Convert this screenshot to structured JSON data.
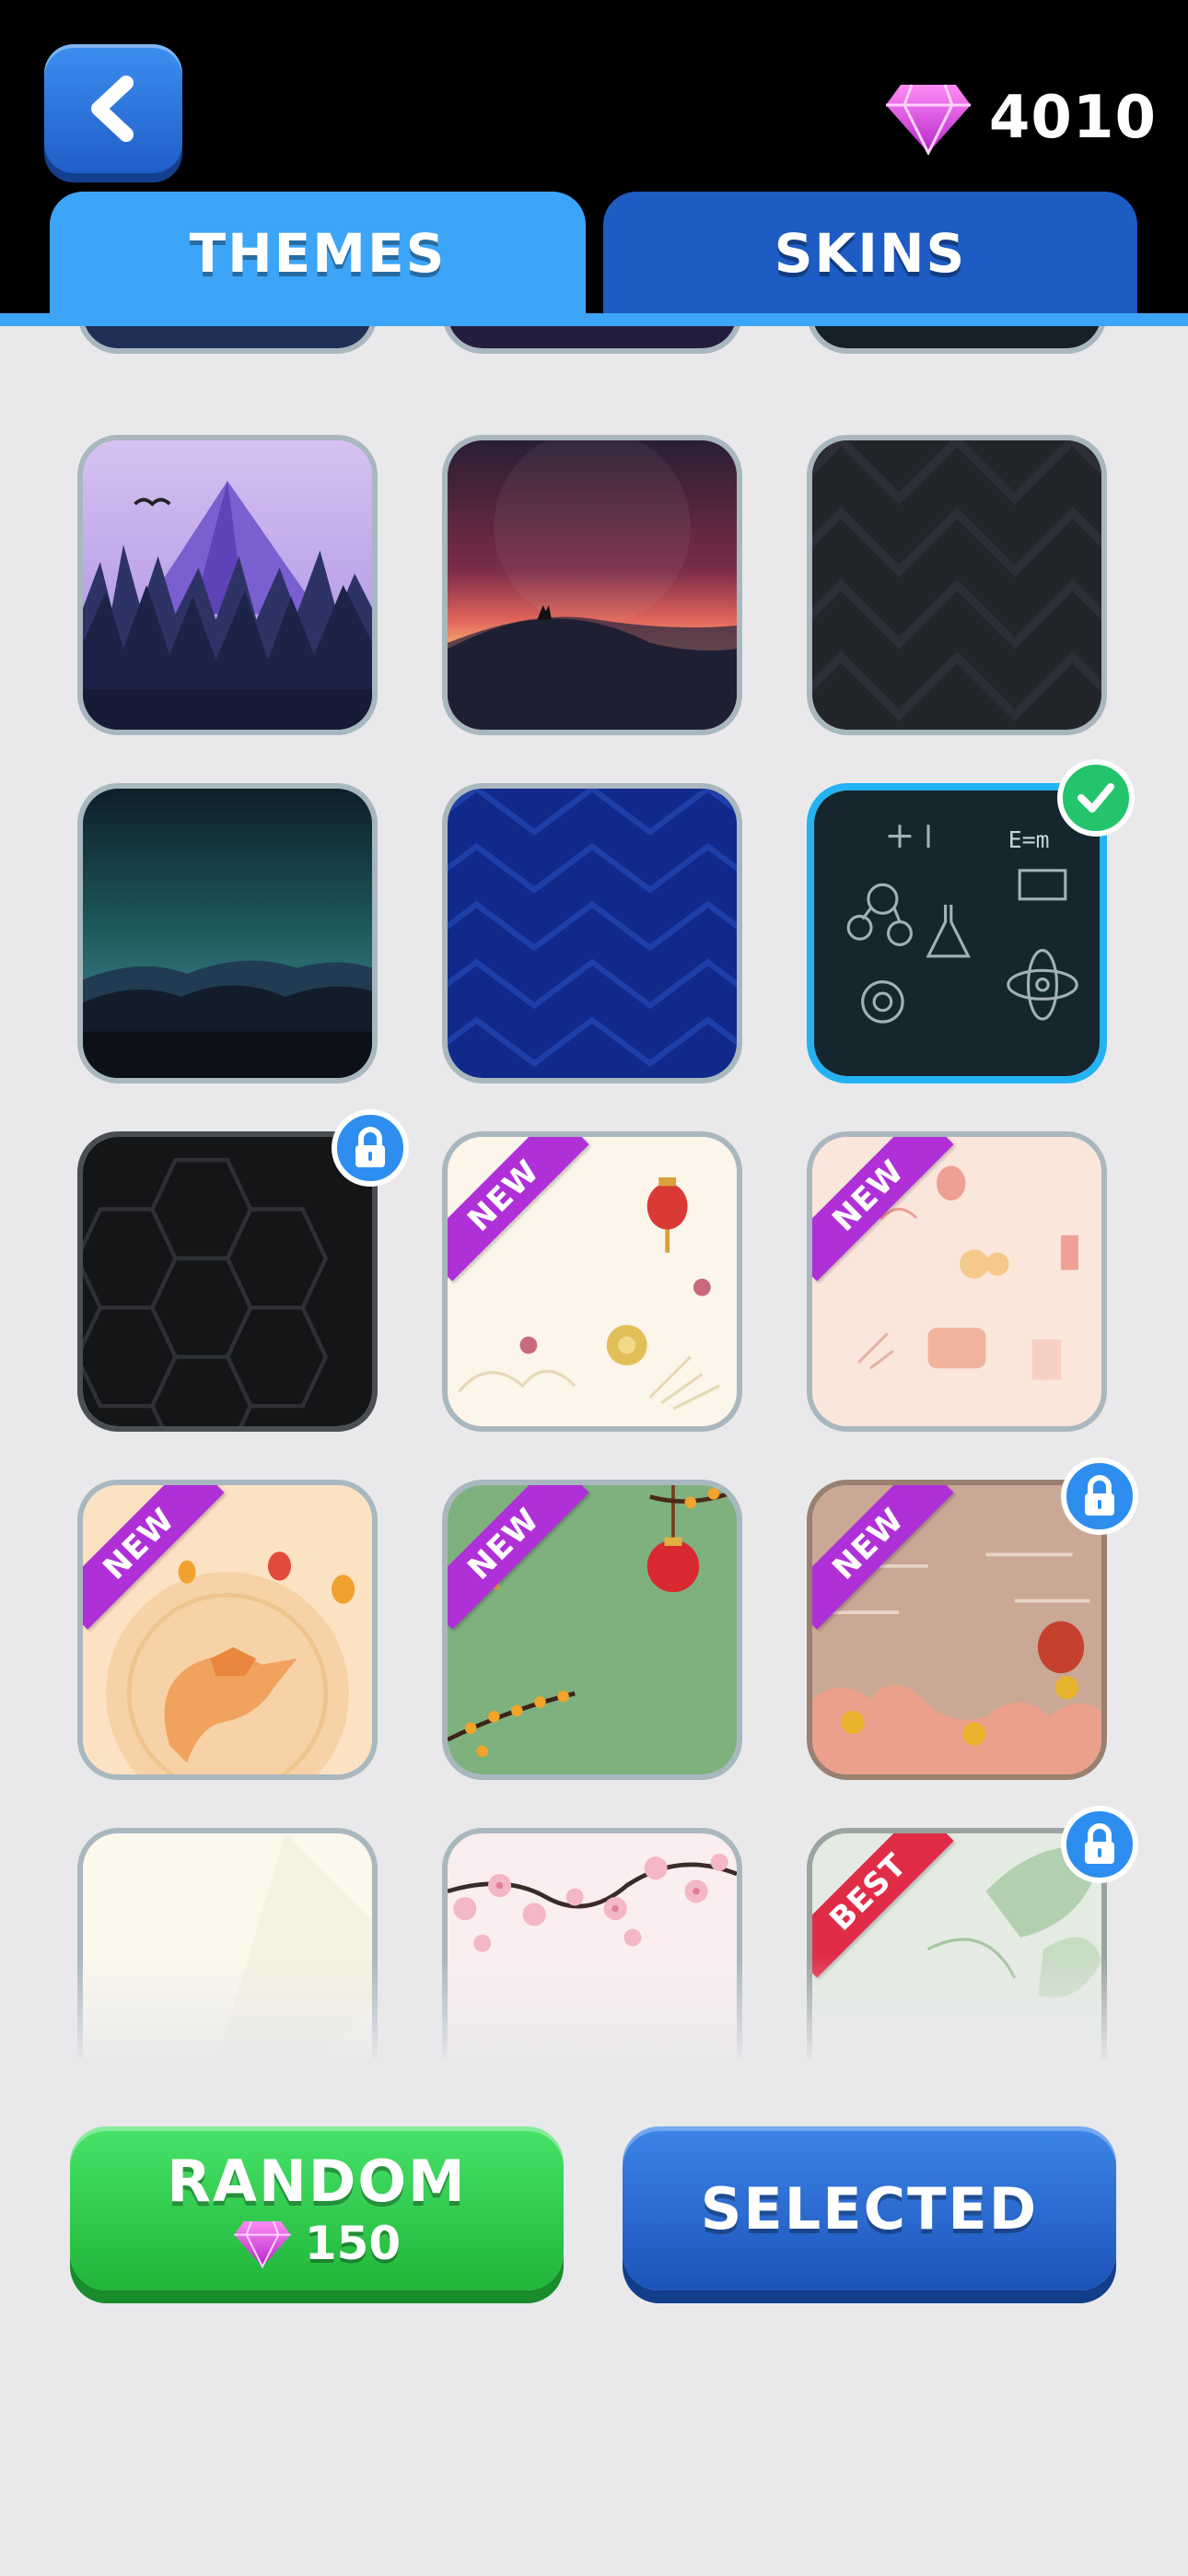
{
  "header": {
    "gems": "4010"
  },
  "tabs": [
    {
      "label": "THEMES",
      "active": true
    },
    {
      "label": "SKINS",
      "active": false
    }
  ],
  "themes": [
    {
      "name": "mountain-forest",
      "label": ""
    },
    {
      "name": "wolf-sunset",
      "label": ""
    },
    {
      "name": "dark-chevron",
      "label": ""
    },
    {
      "name": "aurora",
      "label": ""
    },
    {
      "name": "blue-chevron",
      "label": ""
    },
    {
      "name": "science-chalkboard",
      "label": "",
      "selected": true
    },
    {
      "name": "dark-hexagon",
      "label": "",
      "locked": true
    },
    {
      "name": "lunar-cream",
      "label": "NEW"
    },
    {
      "name": "lunar-peach",
      "label": "NEW"
    },
    {
      "name": "dragon",
      "label": "NEW"
    },
    {
      "name": "green-blossom",
      "label": "NEW"
    },
    {
      "name": "red-clouds",
      "label": "NEW",
      "locked": true
    },
    {
      "name": "plain-cream",
      "label": ""
    },
    {
      "name": "cherry-blossom",
      "label": ""
    },
    {
      "name": "green-leaves",
      "label": "BEST",
      "locked": true
    }
  ],
  "buttons": {
    "random_label": "RANDOM",
    "random_price": "150",
    "selected_label": "SELECTED"
  },
  "colors": {
    "accent": "#3ca5f8",
    "tab_inactive": "#1c5cc3",
    "new_ribbon": "#b030d8",
    "best_ribbon": "#e12c48",
    "gem": "#e040e8"
  }
}
